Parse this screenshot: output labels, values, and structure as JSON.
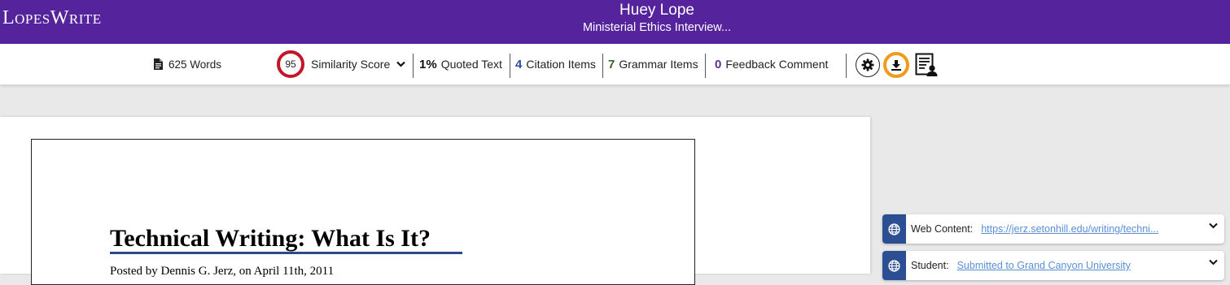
{
  "header": {
    "logo": "LopesWrite",
    "student_name": "Huey Lope",
    "document_title": "Ministerial Ethics Interview..."
  },
  "toolbar": {
    "word_count": "625 Words",
    "similarity_score": "95",
    "similarity_label": "Similarity Score",
    "quoted_value": "1%",
    "quoted_label": "Quoted Text",
    "citation_value": "4",
    "citation_label": "Citation Items",
    "grammar_value": "7",
    "grammar_label": "Grammar Items",
    "feedback_value": "0",
    "feedback_label": "Feedback Comment",
    "icons": [
      "document-icon",
      "chevron-down-icon",
      "gear-icon",
      "download-icon",
      "report-icon"
    ]
  },
  "document": {
    "heading": "Technical Writing: What Is It?",
    "byline": "Posted by Dennis G. Jerz, on April 11th, 2011"
  },
  "matches": [
    {
      "type": "Web Content:",
      "source": "https://jerz.setonhill.edu/writing/techni...",
      "icon": "globe-icon"
    },
    {
      "type": "Student:",
      "source": "Submitted to Grand Canyon University",
      "icon": "globe-icon"
    }
  ],
  "colors": {
    "brand_purple": "#55249c",
    "score_red": "#c31628",
    "highlight_orange": "#f19a1b",
    "card_blue": "#2b4f92"
  }
}
